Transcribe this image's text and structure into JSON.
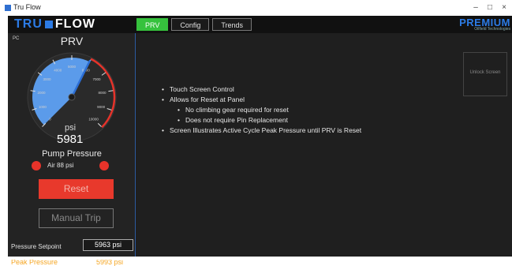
{
  "window": {
    "title": "Tru Flow",
    "min": "–",
    "max": "□",
    "close": "×"
  },
  "header": {
    "logo_left": "TRU",
    "logo_right": "FLOW",
    "tabs": [
      {
        "label": "PRV",
        "active": true
      },
      {
        "label": "Config",
        "active": false
      },
      {
        "label": "Trends",
        "active": false
      }
    ],
    "brand": "PREMIUM",
    "brand_sub": "Oilfield Technologies"
  },
  "panel": {
    "pc_label": "PC",
    "title": "PRV",
    "gauge": {
      "min": 0,
      "max": 10000,
      "value": 5981,
      "ticks": [
        "0",
        "1000",
        "2000",
        "3000",
        "4000",
        "5000",
        "6000",
        "7000",
        "8000",
        "9000",
        "10000"
      ],
      "fill_color": "#5b9bea",
      "redline_color": "#e6332a"
    },
    "unit": "psi",
    "value": "5981",
    "pressure_label": "Pump Pressure",
    "air_label": "Air 88 psi",
    "reset_label": "Reset",
    "manual_trip_label": "Manual Trip",
    "setpoint_label": "Pressure Setpoint",
    "setpoint_value": "5963 psi",
    "peak_label": "Peak Pressure",
    "peak_value": "5993 psi"
  },
  "main": {
    "bullets": [
      {
        "text": "Touch Screen Control",
        "level": 0
      },
      {
        "text": "Allows for Reset at Panel",
        "level": 0
      },
      {
        "text": "No climbing gear required for reset",
        "level": 1
      },
      {
        "text": "Does not require Pin Replacement",
        "level": 1
      },
      {
        "text": "Screen Illustrates Active Cycle Peak Pressure until PRV is Reset",
        "level": 0
      }
    ],
    "unlock_label": "Unlock Screen"
  },
  "colors": {
    "accent": "#36c23d",
    "brand": "#2c7be5",
    "alarm": "#e6332a",
    "peak": "#f5a623"
  }
}
